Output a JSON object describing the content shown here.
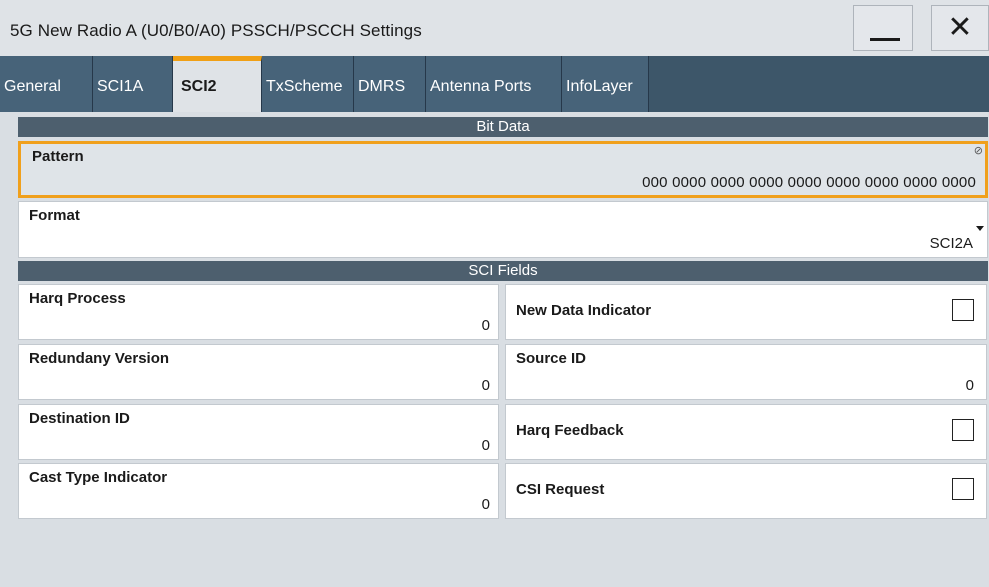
{
  "window": {
    "title": "5G New Radio A (U0/B0/A0) PSSCH/PSCCH Settings",
    "minimize_icon": "minimize-icon",
    "close_icon": "close-icon",
    "close_glyph": "✕"
  },
  "tabs": [
    {
      "label": "General",
      "active": false
    },
    {
      "label": "SCI1A",
      "active": false
    },
    {
      "label": "SCI2",
      "active": true
    },
    {
      "label": "TxScheme",
      "active": false
    },
    {
      "label": "DMRS",
      "active": false
    },
    {
      "label": "Antenna Ports",
      "active": false
    },
    {
      "label": "InfoLayer",
      "active": false
    }
  ],
  "bit_data": {
    "header": "Bit Data",
    "pattern": {
      "label": "Pattern",
      "value": "000 0000 0000 0000 0000 0000 0000 0000 0000",
      "indicator_icon": "edit-indicator-icon"
    },
    "format": {
      "label": "Format",
      "value": "SCI2A"
    }
  },
  "sci_fields": {
    "header": "SCI Fields",
    "harq_process": {
      "label": "Harq Process",
      "value": "0"
    },
    "new_data_indicator": {
      "label": "New Data Indicator",
      "checked": false
    },
    "redundancy_version": {
      "label": "Redundany Version",
      "value": "0"
    },
    "source_id": {
      "label": "Source ID",
      "value": "0"
    },
    "destination_id": {
      "label": "Destination ID",
      "value": "0"
    },
    "harq_feedback": {
      "label": "Harq Feedback",
      "checked": false
    },
    "cast_type_indicator": {
      "label": "Cast Type Indicator",
      "value": "0"
    },
    "csi_request": {
      "label": "CSI Request",
      "checked": false
    }
  },
  "colors": {
    "accent": "#f0a016",
    "tab_bg": "#476379",
    "section_header": "#4d5f6e"
  }
}
